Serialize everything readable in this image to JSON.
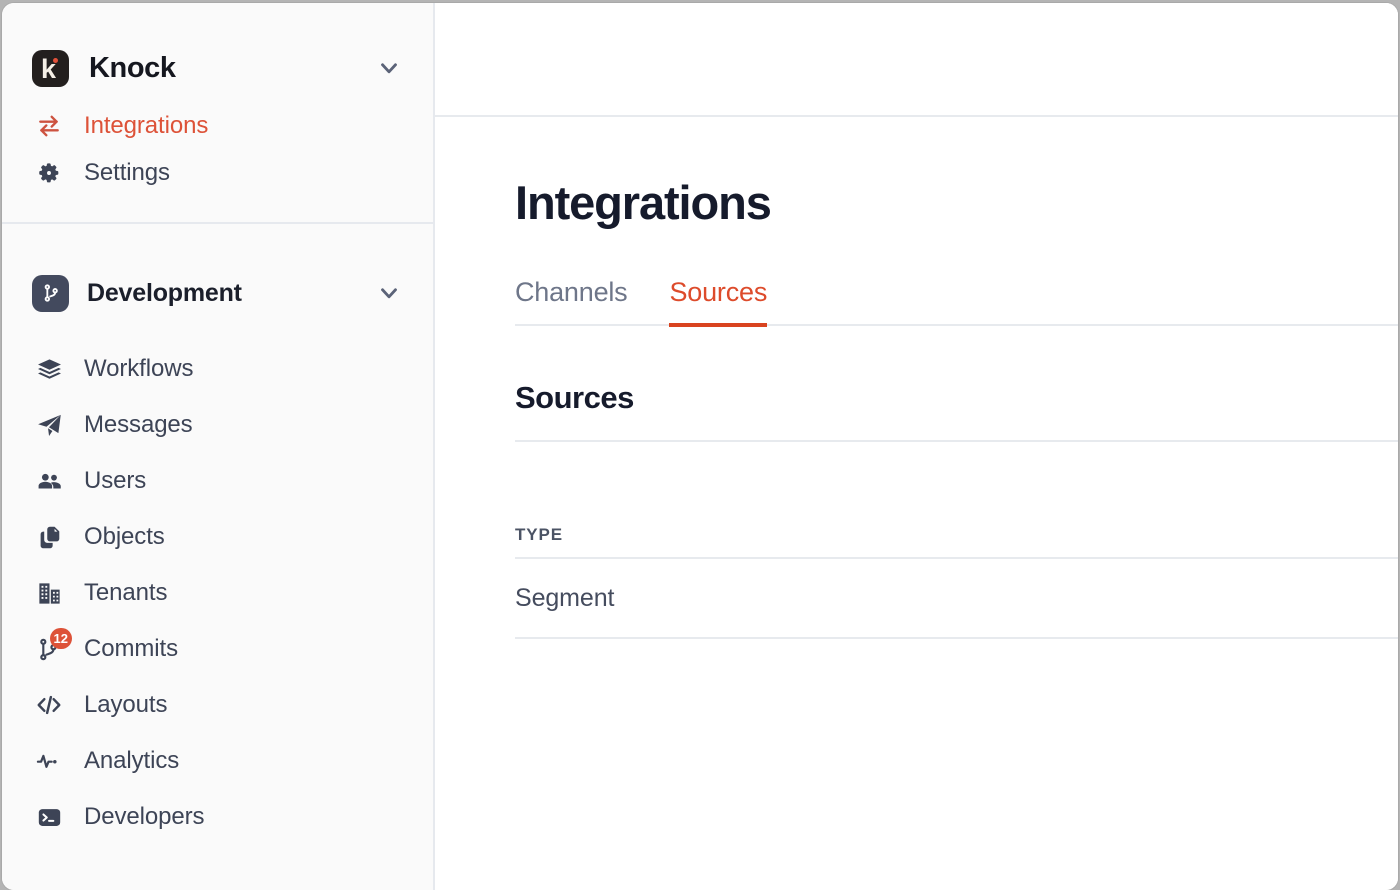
{
  "sidebar": {
    "org": {
      "name": "Knock",
      "logo_glyph": "k",
      "logo_bg": "#231f1e",
      "accent_dot": "#e2513a",
      "chevron": "chevron-down-icon"
    },
    "top_items": [
      {
        "label": "Integrations",
        "icon": "exchange-arrows-icon",
        "active": true
      },
      {
        "label": "Settings",
        "icon": "gear-icon",
        "active": false
      }
    ],
    "environment": {
      "name": "Development",
      "icon": "git-branch-icon",
      "logo_bg": "#434a5e",
      "chevron": "chevron-down-icon"
    },
    "nav_items": [
      {
        "label": "Workflows",
        "icon": "layers-icon",
        "badge": ""
      },
      {
        "label": "Messages",
        "icon": "paper-plane-icon",
        "badge": ""
      },
      {
        "label": "Users",
        "icon": "users-icon",
        "badge": ""
      },
      {
        "label": "Objects",
        "icon": "documents-icon",
        "badge": ""
      },
      {
        "label": "Tenants",
        "icon": "buildings-icon",
        "badge": ""
      },
      {
        "label": "Commits",
        "icon": "git-commit-branch-icon",
        "badge": "12"
      },
      {
        "label": "Layouts",
        "icon": "code-brackets-icon",
        "badge": ""
      },
      {
        "label": "Analytics",
        "icon": "pulse-line-icon",
        "badge": ""
      },
      {
        "label": "Developers",
        "icon": "terminal-icon",
        "badge": ""
      }
    ]
  },
  "main": {
    "page_title": "Integrations",
    "tabs": [
      {
        "label": "Channels",
        "active": false
      },
      {
        "label": "Sources",
        "active": true
      }
    ],
    "section_title": "Sources",
    "table": {
      "columns": [
        "TYPE"
      ],
      "rows": [
        {
          "type": "Segment"
        }
      ]
    }
  },
  "colors": {
    "accent": "#dd5238",
    "tab_underline": "#d9431f",
    "text_dark": "#161b2c",
    "text_muted": "#6e7689",
    "sidebar_bg": "#fafafa",
    "border": "#e7eaee",
    "badge_bg": "#dd5238"
  }
}
